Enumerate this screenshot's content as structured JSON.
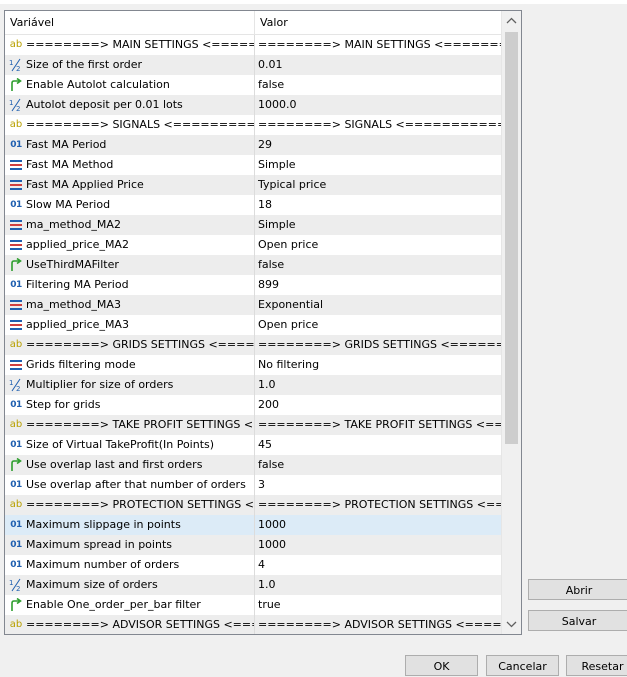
{
  "table": {
    "headers": {
      "variable": "Variável",
      "value": "Valor"
    },
    "rows": [
      {
        "icon": "string-icon",
        "name": "========> MAIN SETTINGS  <=====...",
        "value": "========> MAIN SETTINGS  <=======..."
      },
      {
        "icon": "double-icon",
        "name": "Size of the first order",
        "value": "0.01"
      },
      {
        "icon": "bool-icon",
        "name": "Enable Autolot  calculation",
        "value": "false"
      },
      {
        "icon": "double-icon",
        "name": "Autolot deposit per 0.01 lots",
        "value": "1000.0"
      },
      {
        "icon": "string-icon",
        "name": "========> SIGNALS <===========...",
        "value": "========> SIGNALS <============..."
      },
      {
        "icon": "int-icon",
        "name": "Fast MA Period",
        "value": "29"
      },
      {
        "icon": "enum-icon",
        "name": "Fast MA Method",
        "value": "Simple"
      },
      {
        "icon": "enum-icon",
        "name": "Fast MA Applied Price",
        "value": "Typical price"
      },
      {
        "icon": "int-icon",
        "name": "Slow MA Period",
        "value": "18"
      },
      {
        "icon": "enum-icon",
        "name": "ma_method_MA2",
        "value": "Simple"
      },
      {
        "icon": "enum-icon",
        "name": "applied_price_MA2",
        "value": "Open price"
      },
      {
        "icon": "bool-icon",
        "name": "UseThirdMAFilter",
        "value": "false"
      },
      {
        "icon": "int-icon",
        "name": "Filtering MA Period",
        "value": "899"
      },
      {
        "icon": "enum-icon",
        "name": "ma_method_MA3",
        "value": "Exponential"
      },
      {
        "icon": "enum-icon",
        "name": "applied_price_MA3",
        "value": "Open price"
      },
      {
        "icon": "string-icon",
        "name": "========> GRIDS SETTINGS  <====...",
        "value": "========> GRIDS SETTINGS  <=======..."
      },
      {
        "icon": "enum-icon",
        "name": "Grids filtering mode",
        "value": "No filtering"
      },
      {
        "icon": "double-icon",
        "name": "Multiplier for size of orders",
        "value": "1.0"
      },
      {
        "icon": "int-icon",
        "name": "Step for grids",
        "value": "200"
      },
      {
        "icon": "string-icon",
        "name": "========> TAKE PROFIT SETTINGS  <...",
        "value": "========> TAKE PROFIT SETTINGS  <==..."
      },
      {
        "icon": "int-icon",
        "name": "Size of Virtual TakeProfit(In Points)",
        "value": "45"
      },
      {
        "icon": "bool-icon",
        "name": "Use overlap last and first orders",
        "value": "false"
      },
      {
        "icon": "int-icon",
        "name": "Use overlap after that number of orders",
        "value": "3"
      },
      {
        "icon": "string-icon",
        "name": "========> PROTECTION SETTINGS  <...",
        "value": "========> PROTECTION SETTINGS  <==..."
      },
      {
        "icon": "int-icon",
        "name": "Maximum slippage in points",
        "value": "1000",
        "selected": true
      },
      {
        "icon": "int-icon",
        "name": "Maximum spread in points",
        "value": "1000"
      },
      {
        "icon": "int-icon",
        "name": "Maximum number of orders",
        "value": "4"
      },
      {
        "icon": "double-icon",
        "name": "Maximum size of orders",
        "value": "1.0"
      },
      {
        "icon": "bool-icon",
        "name": "Enable One_order_per_bar filter",
        "value": "true"
      },
      {
        "icon": "string-icon",
        "name": "========> ADVISOR SETTINGS  <===...",
        "value": "========> ADVISOR SETTINGS  <=====..."
      }
    ]
  },
  "buttons": {
    "open": "Abrir",
    "save": "Salvar",
    "ok": "OK",
    "cancel": "Cancelar",
    "reset": "Resetar"
  },
  "colors": {
    "selected_row": "#dcebf7",
    "alt_row": "#ededed",
    "int_icon": "#1f5fb0",
    "bool_icon": "#2e9e2e",
    "string_icon": "#b8a000"
  }
}
